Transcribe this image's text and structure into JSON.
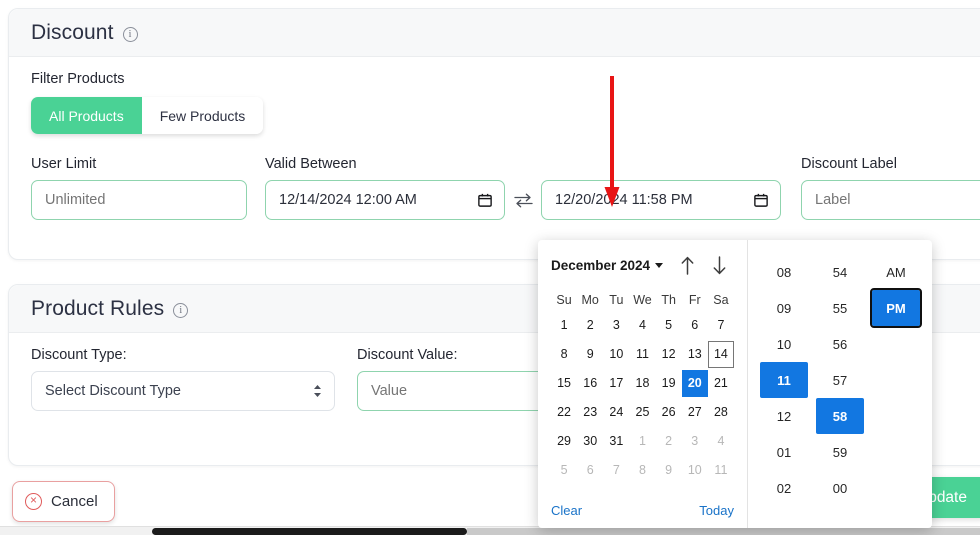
{
  "discount_card": {
    "title": "Discount",
    "info_icon": "info-circle-icon",
    "filter_products": {
      "label": "Filter Products",
      "options": [
        "All Products",
        "Few Products"
      ],
      "selected": "All Products"
    },
    "user_limit": {
      "label": "User Limit",
      "value": "",
      "placeholder": "Unlimited"
    },
    "valid_between": {
      "label": "Valid Between",
      "start": {
        "value": "12/14/2024 12:00 AM",
        "icon": "calendar-icon"
      },
      "swap_icon": "swap-arrows-icon",
      "end": {
        "value": "12/20/2024 11:58 PM",
        "icon": "calendar-icon"
      }
    },
    "discount_label": {
      "label": "Discount Label",
      "value": "",
      "placeholder": "Label"
    }
  },
  "rules_card": {
    "title": "Product Rules",
    "info_icon": "info-circle-icon",
    "discount_type": {
      "label": "Discount Type:",
      "selected": "Select Discount Type"
    },
    "discount_value": {
      "label": "Discount Value:",
      "value": "",
      "placeholder": "Value"
    }
  },
  "footer": {
    "cancel_label": "Cancel",
    "cancel_icon": "x-circle-icon",
    "primary_label": "Update"
  },
  "datetime_picker": {
    "calendar": {
      "month_label": "December 2024",
      "month_dropdown_icon": "caret-down-icon",
      "prev_icon": "arrow-up-icon",
      "next_icon": "arrow-down-icon",
      "weekdays": [
        "Su",
        "Mo",
        "Tu",
        "We",
        "Th",
        "Fr",
        "Sa"
      ],
      "weeks": [
        [
          {
            "d": "1",
            "state": "normal"
          },
          {
            "d": "2",
            "state": "normal"
          },
          {
            "d": "3",
            "state": "normal"
          },
          {
            "d": "4",
            "state": "normal"
          },
          {
            "d": "5",
            "state": "normal"
          },
          {
            "d": "6",
            "state": "normal"
          },
          {
            "d": "7",
            "state": "normal"
          }
        ],
        [
          {
            "d": "8",
            "state": "normal"
          },
          {
            "d": "9",
            "state": "normal"
          },
          {
            "d": "10",
            "state": "normal"
          },
          {
            "d": "11",
            "state": "normal"
          },
          {
            "d": "12",
            "state": "normal"
          },
          {
            "d": "13",
            "state": "normal"
          },
          {
            "d": "14",
            "state": "today"
          }
        ],
        [
          {
            "d": "15",
            "state": "normal"
          },
          {
            "d": "16",
            "state": "normal"
          },
          {
            "d": "17",
            "state": "normal"
          },
          {
            "d": "18",
            "state": "normal"
          },
          {
            "d": "19",
            "state": "normal"
          },
          {
            "d": "20",
            "state": "selected"
          },
          {
            "d": "21",
            "state": "normal"
          }
        ],
        [
          {
            "d": "22",
            "state": "normal"
          },
          {
            "d": "23",
            "state": "normal"
          },
          {
            "d": "24",
            "state": "normal"
          },
          {
            "d": "25",
            "state": "normal"
          },
          {
            "d": "26",
            "state": "normal"
          },
          {
            "d": "27",
            "state": "normal"
          },
          {
            "d": "28",
            "state": "normal"
          }
        ],
        [
          {
            "d": "29",
            "state": "normal"
          },
          {
            "d": "30",
            "state": "normal"
          },
          {
            "d": "31",
            "state": "normal"
          },
          {
            "d": "1",
            "state": "muted"
          },
          {
            "d": "2",
            "state": "muted"
          },
          {
            "d": "3",
            "state": "muted"
          },
          {
            "d": "4",
            "state": "muted"
          }
        ],
        [
          {
            "d": "5",
            "state": "muted"
          },
          {
            "d": "6",
            "state": "muted"
          },
          {
            "d": "7",
            "state": "muted"
          },
          {
            "d": "8",
            "state": "muted"
          },
          {
            "d": "9",
            "state": "muted"
          },
          {
            "d": "10",
            "state": "muted"
          },
          {
            "d": "11",
            "state": "muted"
          }
        ]
      ],
      "clear_label": "Clear",
      "today_label": "Today"
    },
    "time": {
      "hours": [
        {
          "v": "08",
          "state": "normal"
        },
        {
          "v": "09",
          "state": "normal"
        },
        {
          "v": "10",
          "state": "normal"
        },
        {
          "v": "11",
          "state": "selected"
        },
        {
          "v": "12",
          "state": "normal"
        },
        {
          "v": "01",
          "state": "normal"
        },
        {
          "v": "02",
          "state": "normal"
        }
      ],
      "minutes": [
        {
          "v": "54",
          "state": "normal"
        },
        {
          "v": "55",
          "state": "normal"
        },
        {
          "v": "56",
          "state": "normal"
        },
        {
          "v": "57",
          "state": "normal"
        },
        {
          "v": "58",
          "state": "selected"
        },
        {
          "v": "59",
          "state": "normal"
        },
        {
          "v": "00",
          "state": "normal"
        }
      ],
      "meridiem": [
        {
          "v": "AM",
          "state": "normal"
        },
        {
          "v": "PM",
          "state": "selected-focused"
        }
      ]
    }
  },
  "annotation": {
    "arrow_icon": "red-down-arrow-annotation",
    "color": "#e81515"
  },
  "colors": {
    "accent_green": "#4ad295",
    "input_border_green": "#8fd4ae",
    "selection_blue": "#1277e1",
    "link_blue": "#1a73c8",
    "cancel_red": "#e05c5c",
    "header_bg": "#f7f8f9"
  }
}
